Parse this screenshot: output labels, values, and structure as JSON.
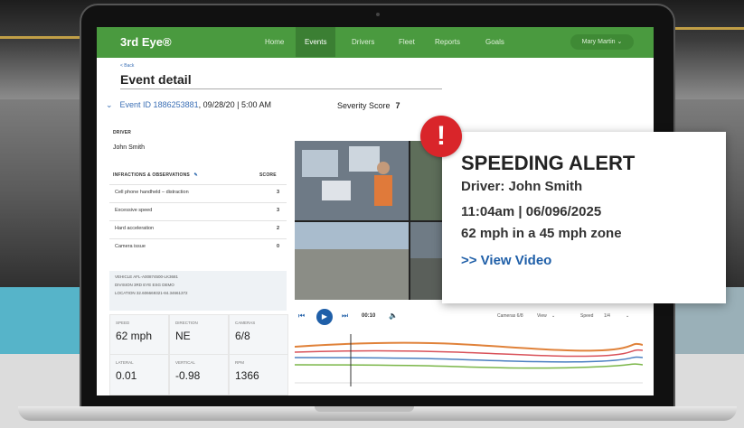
{
  "nav": {
    "brand": "3rd Eye®",
    "items": [
      "Home",
      "Events",
      "Drivers",
      "Fleet",
      "Reports",
      "Goals"
    ],
    "user": "Mary Martin ⌄"
  },
  "page": {
    "back": "< Back",
    "title": "Event detail"
  },
  "event": {
    "id_label": "Event ID 1886253881",
    "datetime": ", 09/28/20 | 5:00 AM",
    "severity_label": "Severity Score",
    "severity_value": "7"
  },
  "driver": {
    "label": "DRIVER",
    "name": "John Smith"
  },
  "infractions": {
    "header": "INFRACTIONS & OBSERVATIONS",
    "score_header": "SCORE",
    "rows": [
      {
        "label": "Cell phone handheld – distraction",
        "score": "3"
      },
      {
        "label": "Excessive speed",
        "score": "3"
      },
      {
        "label": "Hard acceleration",
        "score": "2"
      },
      {
        "label": "Camera issue",
        "score": "0"
      }
    ]
  },
  "vehicle": {
    "vehicle": "VEHICLE  AFL-A00874500-LK3681",
    "division": "DIVISION  3RD EYE ESG DEMO",
    "location": "LOCATION  32.606669321-84.34661372"
  },
  "stats": [
    {
      "label": "SPEED",
      "value": "62 mph"
    },
    {
      "label": "DIRECTION",
      "value": "NE"
    },
    {
      "label": "CAMERAS",
      "value": "6/8"
    },
    {
      "label": "LATERAL",
      "value": "0.01"
    },
    {
      "label": "VERTICAL",
      "value": "-0.98"
    },
    {
      "label": "RPM",
      "value": "1366"
    }
  ],
  "player": {
    "time": "00:10",
    "cameras": "Cameras 6/8",
    "view": "View",
    "speed": "Speed",
    "rate": "1/4"
  },
  "alert": {
    "title": "SPEEDING ALERT",
    "driver": "Driver: John Smith",
    "when": "11:04am | 06/096/2025",
    "detail": "62 mph in a 45 mph zone",
    "link": ">> View Video"
  },
  "colors": {
    "nav_green": "#4a9a3f",
    "accent_blue": "#1f5fa8",
    "alert_red": "#d9252a"
  }
}
